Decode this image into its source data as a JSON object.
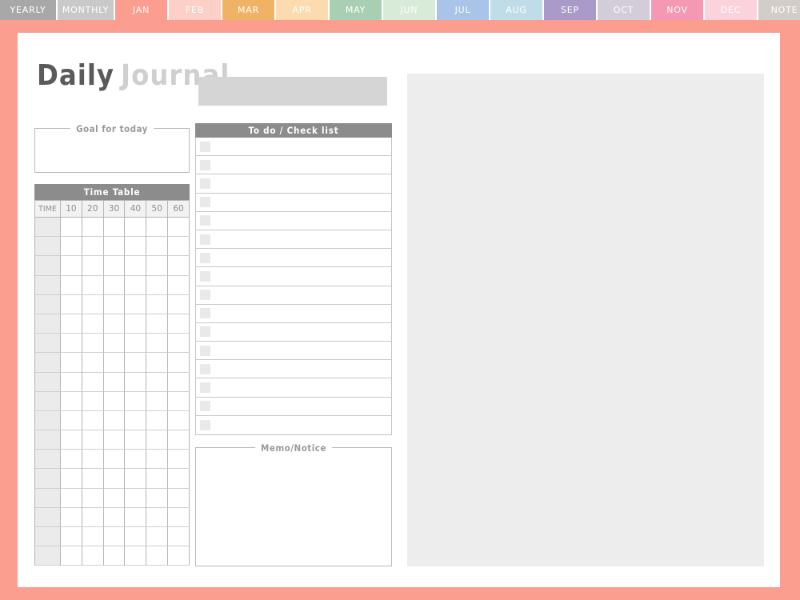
{
  "tabs": [
    {
      "label": "YEARLY",
      "color": "#a8a8a8",
      "active": false,
      "wide": true
    },
    {
      "label": "MONTHLY",
      "color": "#c9c9c9",
      "active": false,
      "wide": true
    },
    {
      "label": "JAN",
      "color": "#fb9d8f",
      "active": true,
      "wide": false
    },
    {
      "label": "FEB",
      "color": "#fccfc9",
      "active": false,
      "wide": false
    },
    {
      "label": "MAR",
      "color": "#f0b265",
      "active": false,
      "wide": false
    },
    {
      "label": "APR",
      "color": "#fcdcae",
      "active": false,
      "wide": false
    },
    {
      "label": "MAY",
      "color": "#a9cfb2",
      "active": false,
      "wide": false
    },
    {
      "label": "JUN",
      "color": "#d8ebd9",
      "active": false,
      "wide": false
    },
    {
      "label": "JUL",
      "color": "#a9c4e8",
      "active": false,
      "wide": false
    },
    {
      "label": "AUG",
      "color": "#bfdde8",
      "active": false,
      "wide": false
    },
    {
      "label": "SEP",
      "color": "#a99ac9",
      "active": false,
      "wide": false
    },
    {
      "label": "OCT",
      "color": "#d3cdd9",
      "active": false,
      "wide": false
    },
    {
      "label": "NOV",
      "color": "#f598b4",
      "active": false,
      "wide": false
    },
    {
      "label": "DEC",
      "color": "#fbd3dd",
      "active": false,
      "wide": false
    },
    {
      "label": "NOTE",
      "color": "#d2cdc8",
      "active": false,
      "wide": false
    }
  ],
  "page": {
    "frame_color": "#fb9d8f",
    "title_primary": "Daily",
    "title_secondary": "Journal",
    "date_value": ""
  },
  "goal": {
    "label": "Goal for today",
    "value": ""
  },
  "timetable": {
    "header": "Time Table",
    "columns": [
      "TIME",
      "10",
      "20",
      "30",
      "40",
      "50",
      "60"
    ],
    "row_count": 18,
    "rows": [
      [
        "",
        "",
        "",
        "",
        "",
        "",
        ""
      ],
      [
        "",
        "",
        "",
        "",
        "",
        "",
        ""
      ],
      [
        "",
        "",
        "",
        "",
        "",
        "",
        ""
      ],
      [
        "",
        "",
        "",
        "",
        "",
        "",
        ""
      ],
      [
        "",
        "",
        "",
        "",
        "",
        "",
        ""
      ],
      [
        "",
        "",
        "",
        "",
        "",
        "",
        ""
      ],
      [
        "",
        "",
        "",
        "",
        "",
        "",
        ""
      ],
      [
        "",
        "",
        "",
        "",
        "",
        "",
        ""
      ],
      [
        "",
        "",
        "",
        "",
        "",
        "",
        ""
      ],
      [
        "",
        "",
        "",
        "",
        "",
        "",
        ""
      ],
      [
        "",
        "",
        "",
        "",
        "",
        "",
        ""
      ],
      [
        "",
        "",
        "",
        "",
        "",
        "",
        ""
      ],
      [
        "",
        "",
        "",
        "",
        "",
        "",
        ""
      ],
      [
        "",
        "",
        "",
        "",
        "",
        "",
        ""
      ],
      [
        "",
        "",
        "",
        "",
        "",
        "",
        ""
      ],
      [
        "",
        "",
        "",
        "",
        "",
        "",
        ""
      ],
      [
        "",
        "",
        "",
        "",
        "",
        "",
        ""
      ],
      [
        "",
        "",
        "",
        "",
        "",
        "",
        ""
      ]
    ]
  },
  "todo": {
    "header": "To do / Check list",
    "item_count": 16,
    "items": [
      {
        "checked": false,
        "text": ""
      },
      {
        "checked": false,
        "text": ""
      },
      {
        "checked": false,
        "text": ""
      },
      {
        "checked": false,
        "text": ""
      },
      {
        "checked": false,
        "text": ""
      },
      {
        "checked": false,
        "text": ""
      },
      {
        "checked": false,
        "text": ""
      },
      {
        "checked": false,
        "text": ""
      },
      {
        "checked": false,
        "text": ""
      },
      {
        "checked": false,
        "text": ""
      },
      {
        "checked": false,
        "text": ""
      },
      {
        "checked": false,
        "text": ""
      },
      {
        "checked": false,
        "text": ""
      },
      {
        "checked": false,
        "text": ""
      },
      {
        "checked": false,
        "text": ""
      },
      {
        "checked": false,
        "text": ""
      }
    ]
  },
  "memo": {
    "label": "Memo/Notice",
    "value": ""
  },
  "right_panel": {
    "value": ""
  },
  "colors": {
    "accent": "#fb9d8f",
    "header_gray": "#8c8c8c",
    "panel_gray": "#ededed",
    "date_gray": "#d5d5d5",
    "title_dark": "#5a5a5a",
    "title_light": "#cfcfcf"
  }
}
